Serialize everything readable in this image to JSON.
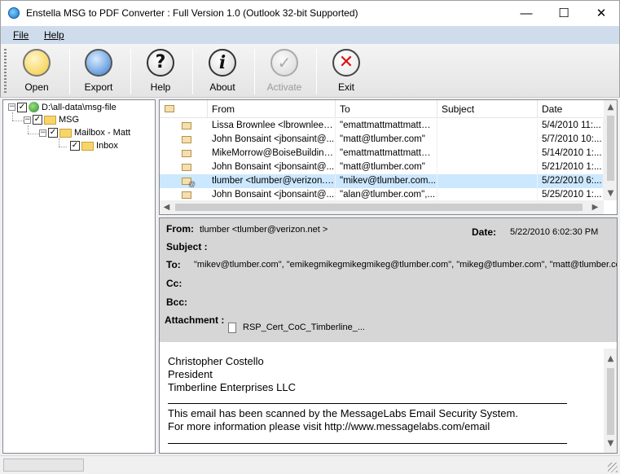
{
  "window": {
    "title": "Enstella MSG to PDF Converter : Full Version 1.0 (Outlook 32-bit Supported)",
    "minimize": "—",
    "maximize": "☐",
    "close": "✕"
  },
  "menu": {
    "file": "File",
    "help": "Help"
  },
  "toolbar": {
    "open": "Open",
    "export": "Export",
    "help": "Help",
    "about": "About",
    "activate": "Activate",
    "exit": "Exit"
  },
  "tree": {
    "root": "D:\\all-data\\msg-file",
    "msg": "MSG",
    "mailbox": "Mailbox - Matt",
    "inbox": "Inbox"
  },
  "list": {
    "columns": {
      "from": "From",
      "to": "To",
      "subject": "Subject",
      "date": "Date"
    },
    "rows": [
      {
        "from": "Lissa Brownlee <lbrownlee@...",
        "to": "\"emattmattmattmatt@...",
        "subject": "",
        "date": "5/4/2010 11:..."
      },
      {
        "from": "John Bonsaint <jbonsaint@...",
        "to": "\"matt@tlumber.com\"",
        "subject": "",
        "date": "5/7/2010 10:..."
      },
      {
        "from": "MikeMorrow@BoiseBuilding....",
        "to": "\"emattmattmattmatt@...",
        "subject": "",
        "date": "5/14/2010 1:..."
      },
      {
        "from": "John Bonsaint <jbonsaint@...",
        "to": "\"matt@tlumber.com\"",
        "subject": "",
        "date": "5/21/2010 1:..."
      },
      {
        "from": "tlumber <tlumber@verizon.n...",
        "to": "\"mikev@tlumber.com...",
        "subject": "",
        "date": "5/22/2010 6:..."
      },
      {
        "from": "John Bonsaint <jbonsaint@...",
        "to": "\"alan@tlumber.com\",...",
        "subject": "",
        "date": "5/25/2010 1:..."
      }
    ]
  },
  "preview": {
    "labels": {
      "from": "From:",
      "subject": "Subject :",
      "to": "To:",
      "cc": "Cc:",
      "bcc": "Bcc:",
      "attachment": "Attachment :",
      "date": "Date:"
    },
    "from": "tlumber <tlumber@verizon.net >",
    "date": "5/22/2010 6:02:30 PM",
    "subject": "",
    "to": "\"mikev@tlumber.com\", \"emikegmikegmikegmikeg@tlumber.com\", \"mikeg@tlumber.com\", \"matt@tlumber.com\"",
    "cc": "",
    "bcc": "",
    "attachment": "RSP_Cert_CoC_Timberline_...",
    "body": {
      "line1": "Christopher Costello",
      "line2": "President",
      "line3": "Timberline Enterprises LLC",
      "line4": "This email has been scanned by the MessageLabs Email Security System.",
      "line5": "For more information please visit http://www.messagelabs.com/email"
    }
  },
  "scroll": {
    "up": "▲",
    "down": "▼",
    "left": "◀",
    "right": "▶"
  }
}
